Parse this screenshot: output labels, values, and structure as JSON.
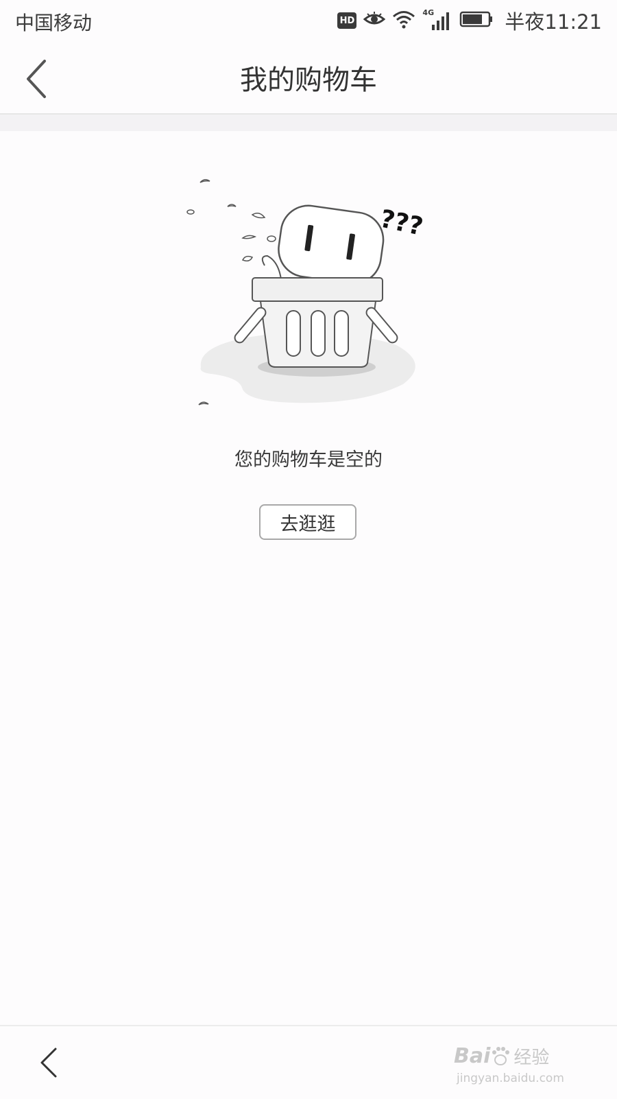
{
  "status_bar": {
    "carrier": "中国移动",
    "hd_badge": "HD",
    "network": "4G",
    "time": "半夜11:21"
  },
  "header": {
    "title": "我的购物车",
    "back_icon": "chevron-left-icon"
  },
  "empty_state": {
    "message": "您的购物车是空的",
    "question_marks": "???",
    "illustration": "robot-in-basket"
  },
  "actions": {
    "go_shopping_label": "去逛逛"
  },
  "bottom_nav": {
    "back_icon": "chevron-left-icon"
  },
  "watermark": {
    "brand": "Bai",
    "brand_suffix": "经验",
    "url": "jingyan.baidu.com"
  },
  "colors": {
    "background": "#fdfcfd",
    "text": "#333333",
    "divider": "#e6e6e6",
    "band": "#f3f2f4"
  }
}
